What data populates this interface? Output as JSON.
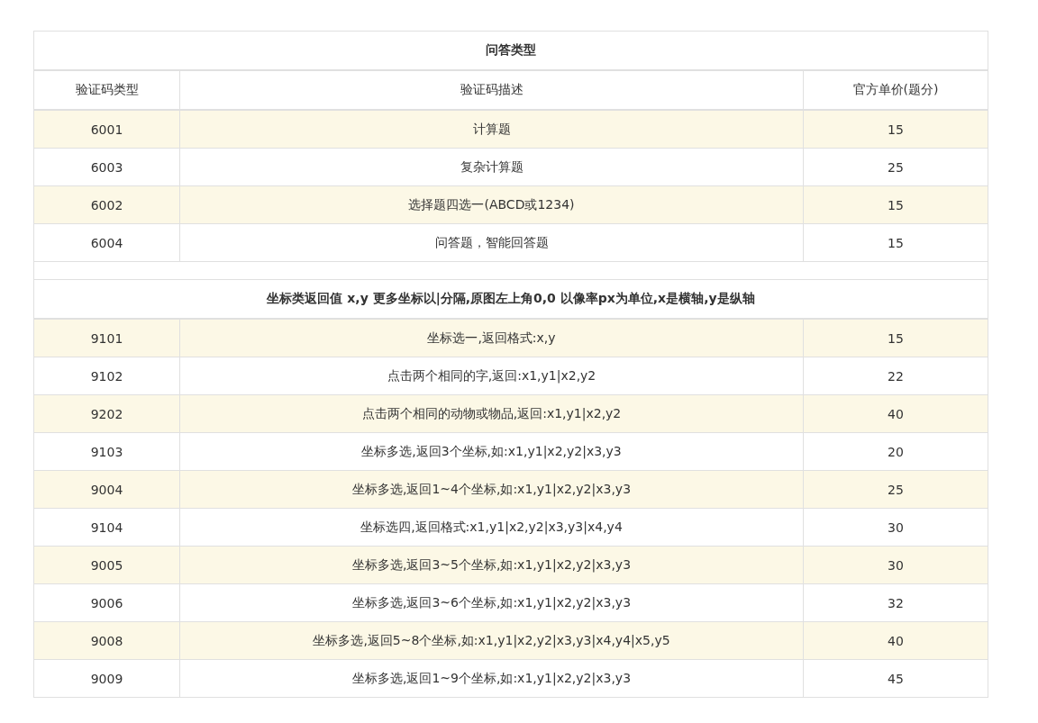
{
  "sections": [
    {
      "title": "问答类型",
      "columns": [
        "验证码类型",
        "验证码描述",
        "官方单价(题分)"
      ],
      "rows": [
        {
          "code": "6001",
          "description": "计算题",
          "price": "15"
        },
        {
          "code": "6003",
          "description": "复杂计算题",
          "price": "25"
        },
        {
          "code": "6002",
          "description": "选择题四选一(ABCD或1234)",
          "price": "15"
        },
        {
          "code": "6004",
          "description": "问答题，智能回答题",
          "price": "15"
        }
      ]
    },
    {
      "title": "坐标类返回值 x,y 更多坐标以|分隔,原图左上角0,0 以像率px为单位,x是横轴,y是纵轴",
      "rows": [
        {
          "code": "9101",
          "description": "坐标选一,返回格式:x,y",
          "price": "15"
        },
        {
          "code": "9102",
          "description": "点击两个相同的字,返回:x1,y1|x2,y2",
          "price": "22"
        },
        {
          "code": "9202",
          "description": "点击两个相同的动物或物品,返回:x1,y1|x2,y2",
          "price": "40"
        },
        {
          "code": "9103",
          "description": "坐标多选,返回3个坐标,如:x1,y1|x2,y2|x3,y3",
          "price": "20"
        },
        {
          "code": "9004",
          "description": "坐标多选,返回1~4个坐标,如:x1,y1|x2,y2|x3,y3",
          "price": "25"
        },
        {
          "code": "9104",
          "description": "坐标选四,返回格式:x1,y1|x2,y2|x3,y3|x4,y4",
          "price": "30"
        },
        {
          "code": "9005",
          "description": "坐标多选,返回3~5个坐标,如:x1,y1|x2,y2|x3,y3",
          "price": "30"
        },
        {
          "code": "9006",
          "description": "坐标多选,返回3~6个坐标,如:x1,y1|x2,y2|x3,y3",
          "price": "32"
        },
        {
          "code": "9008",
          "description": "坐标多选,返回5~8个坐标,如:x1,y1|x2,y2|x3,y3|x4,y4|x5,y5",
          "price": "40"
        },
        {
          "code": "9009",
          "description": "坐标多选,返回1~9个坐标,如:x1,y1|x2,y2|x3,y3",
          "price": "45"
        }
      ]
    }
  ]
}
